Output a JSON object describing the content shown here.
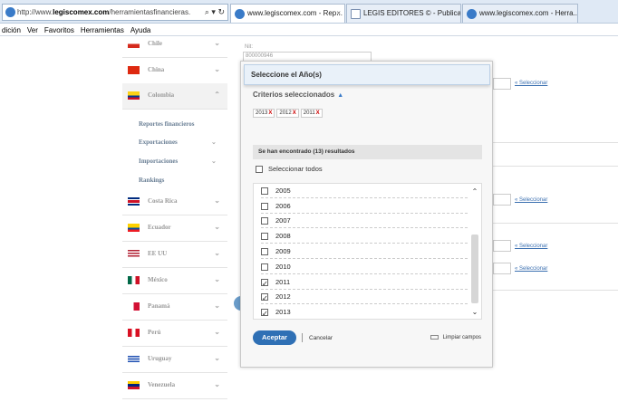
{
  "browser": {
    "url_prefix": "http://www.",
    "url_host": "legiscomex.com",
    "url_rest": "/herramientasfinancieras.",
    "url_controls": "⌕ ▾ ↻",
    "tabs": [
      {
        "label": "www.legiscomex.com - Rep...",
        "close": "×",
        "active": true
      },
      {
        "label": "LEGIS EDITORES © - Publicaci...",
        "active": false
      },
      {
        "label": "www.legiscomex.com - Herra...",
        "active": false
      }
    ],
    "menu": [
      "dición",
      "Ver",
      "Favoritos",
      "Herramientas",
      "Ayuda"
    ]
  },
  "sidebar": {
    "countries": [
      {
        "label": "Chile",
        "colors": [
          "#fff",
          "#d52b1e"
        ]
      },
      {
        "label": "China",
        "colors": [
          "#de2910",
          "#de2910"
        ]
      },
      {
        "label": "Colombia",
        "colors": [
          "#fcd116",
          "#003893",
          "#ce1126"
        ]
      },
      {
        "label": "Costa Rica",
        "colors": [
          "#002b7f",
          "#ce1126",
          "#002b7f"
        ]
      },
      {
        "label": "Ecuador",
        "colors": [
          "#ffd100",
          "#034ea2",
          "#ed1c24"
        ]
      },
      {
        "label": "EE UU",
        "colors": [
          "#b22234",
          "#fff",
          "#3c3b6e"
        ]
      },
      {
        "label": "México",
        "colors": [
          "#006847",
          "#fff",
          "#ce1126"
        ]
      },
      {
        "label": "Panamá",
        "colors": [
          "#fff",
          "#d21034",
          "#005293"
        ]
      },
      {
        "label": "Perú",
        "colors": [
          "#d91023",
          "#fff",
          "#d91023"
        ]
      },
      {
        "label": "Uruguay",
        "colors": [
          "#fff",
          "#0038a8",
          "#fff"
        ]
      },
      {
        "label": "Venezuela",
        "colors": [
          "#ffcc00",
          "#00247d",
          "#cf142b"
        ]
      }
    ],
    "colombia_sub": [
      {
        "label": "Reportes financieros",
        "chev": ""
      },
      {
        "label": "Exportaciones",
        "chev": "⌄"
      },
      {
        "label": "Importaciones",
        "chev": "⌄"
      },
      {
        "label": "Rankings",
        "chev": ""
      }
    ],
    "chev_down": "⌄",
    "chev_up": "⌃"
  },
  "form": {
    "nit_label": "Nit:",
    "nit_value": "800000946",
    "select_link": "« Seleccionar"
  },
  "modal": {
    "title": "Seleccione el Año(s)",
    "criteria_label": "Criterios seleccionados",
    "criteria_icon": "▲",
    "tags": [
      "2013",
      "2012",
      "2011"
    ],
    "tag_remove": "X",
    "results_text": "Se han encontrado (13) resultados",
    "select_all_label": "Seleccionar todos",
    "years": [
      {
        "label": "2005",
        "checked": false
      },
      {
        "label": "2006",
        "checked": false
      },
      {
        "label": "2007",
        "checked": false
      },
      {
        "label": "2008",
        "checked": false
      },
      {
        "label": "2009",
        "checked": false
      },
      {
        "label": "2010",
        "checked": false
      },
      {
        "label": "2011",
        "checked": true
      },
      {
        "label": "2012",
        "checked": true
      },
      {
        "label": "2013",
        "checked": true
      }
    ],
    "scroll_up": "⌃",
    "scroll_down": "⌄",
    "accept_label": "Aceptar",
    "cancel_label": "Cancelar",
    "clear_label": "Limpiar campos"
  }
}
